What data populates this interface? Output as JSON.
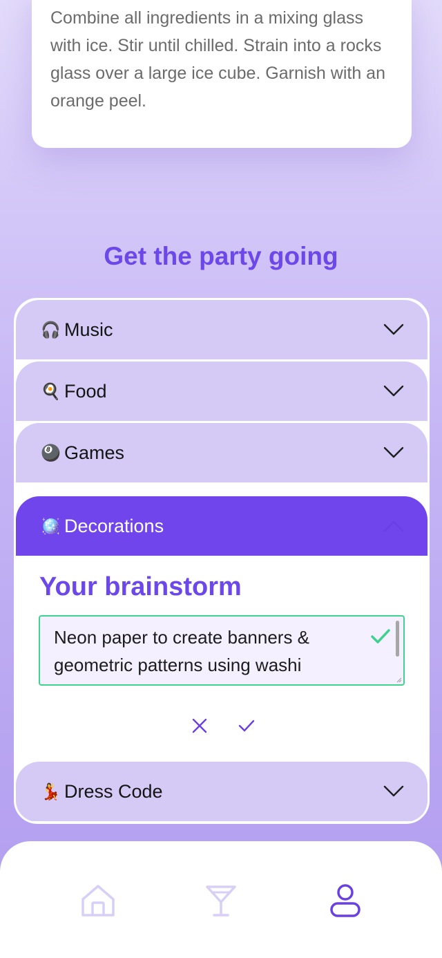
{
  "recipe": {
    "instructions": "Combine all ingredients in a mixing glass with ice. Stir until chilled. Strain into a rocks glass over a large ice cube. Garnish with an orange peel."
  },
  "party": {
    "title": "Get the party going",
    "sections": [
      {
        "emoji": "🎧",
        "label": "Music",
        "expanded": false
      },
      {
        "emoji": "🍳",
        "label": "Food",
        "expanded": false
      },
      {
        "emoji": "🎱",
        "label": "Games",
        "expanded": false
      },
      {
        "emoji": "🪩",
        "label": "Decorations",
        "expanded": true
      },
      {
        "emoji": "💃",
        "label": "Dress Code",
        "expanded": false
      }
    ],
    "brainstorm": {
      "title": "Your brainstorm",
      "value": "Neon paper to create banners & geometric patterns using washi"
    }
  },
  "nav": {
    "items": [
      {
        "icon": "home-icon",
        "active": false
      },
      {
        "icon": "cocktail-icon",
        "active": false
      },
      {
        "icon": "profile-icon",
        "active": true
      }
    ]
  },
  "colors": {
    "accent": "#6c47ea",
    "accent_dark": "#7045ec",
    "section_bg": "#d5c9f6",
    "valid": "#3fd28e",
    "nav_inactive": "#d8cff7"
  }
}
